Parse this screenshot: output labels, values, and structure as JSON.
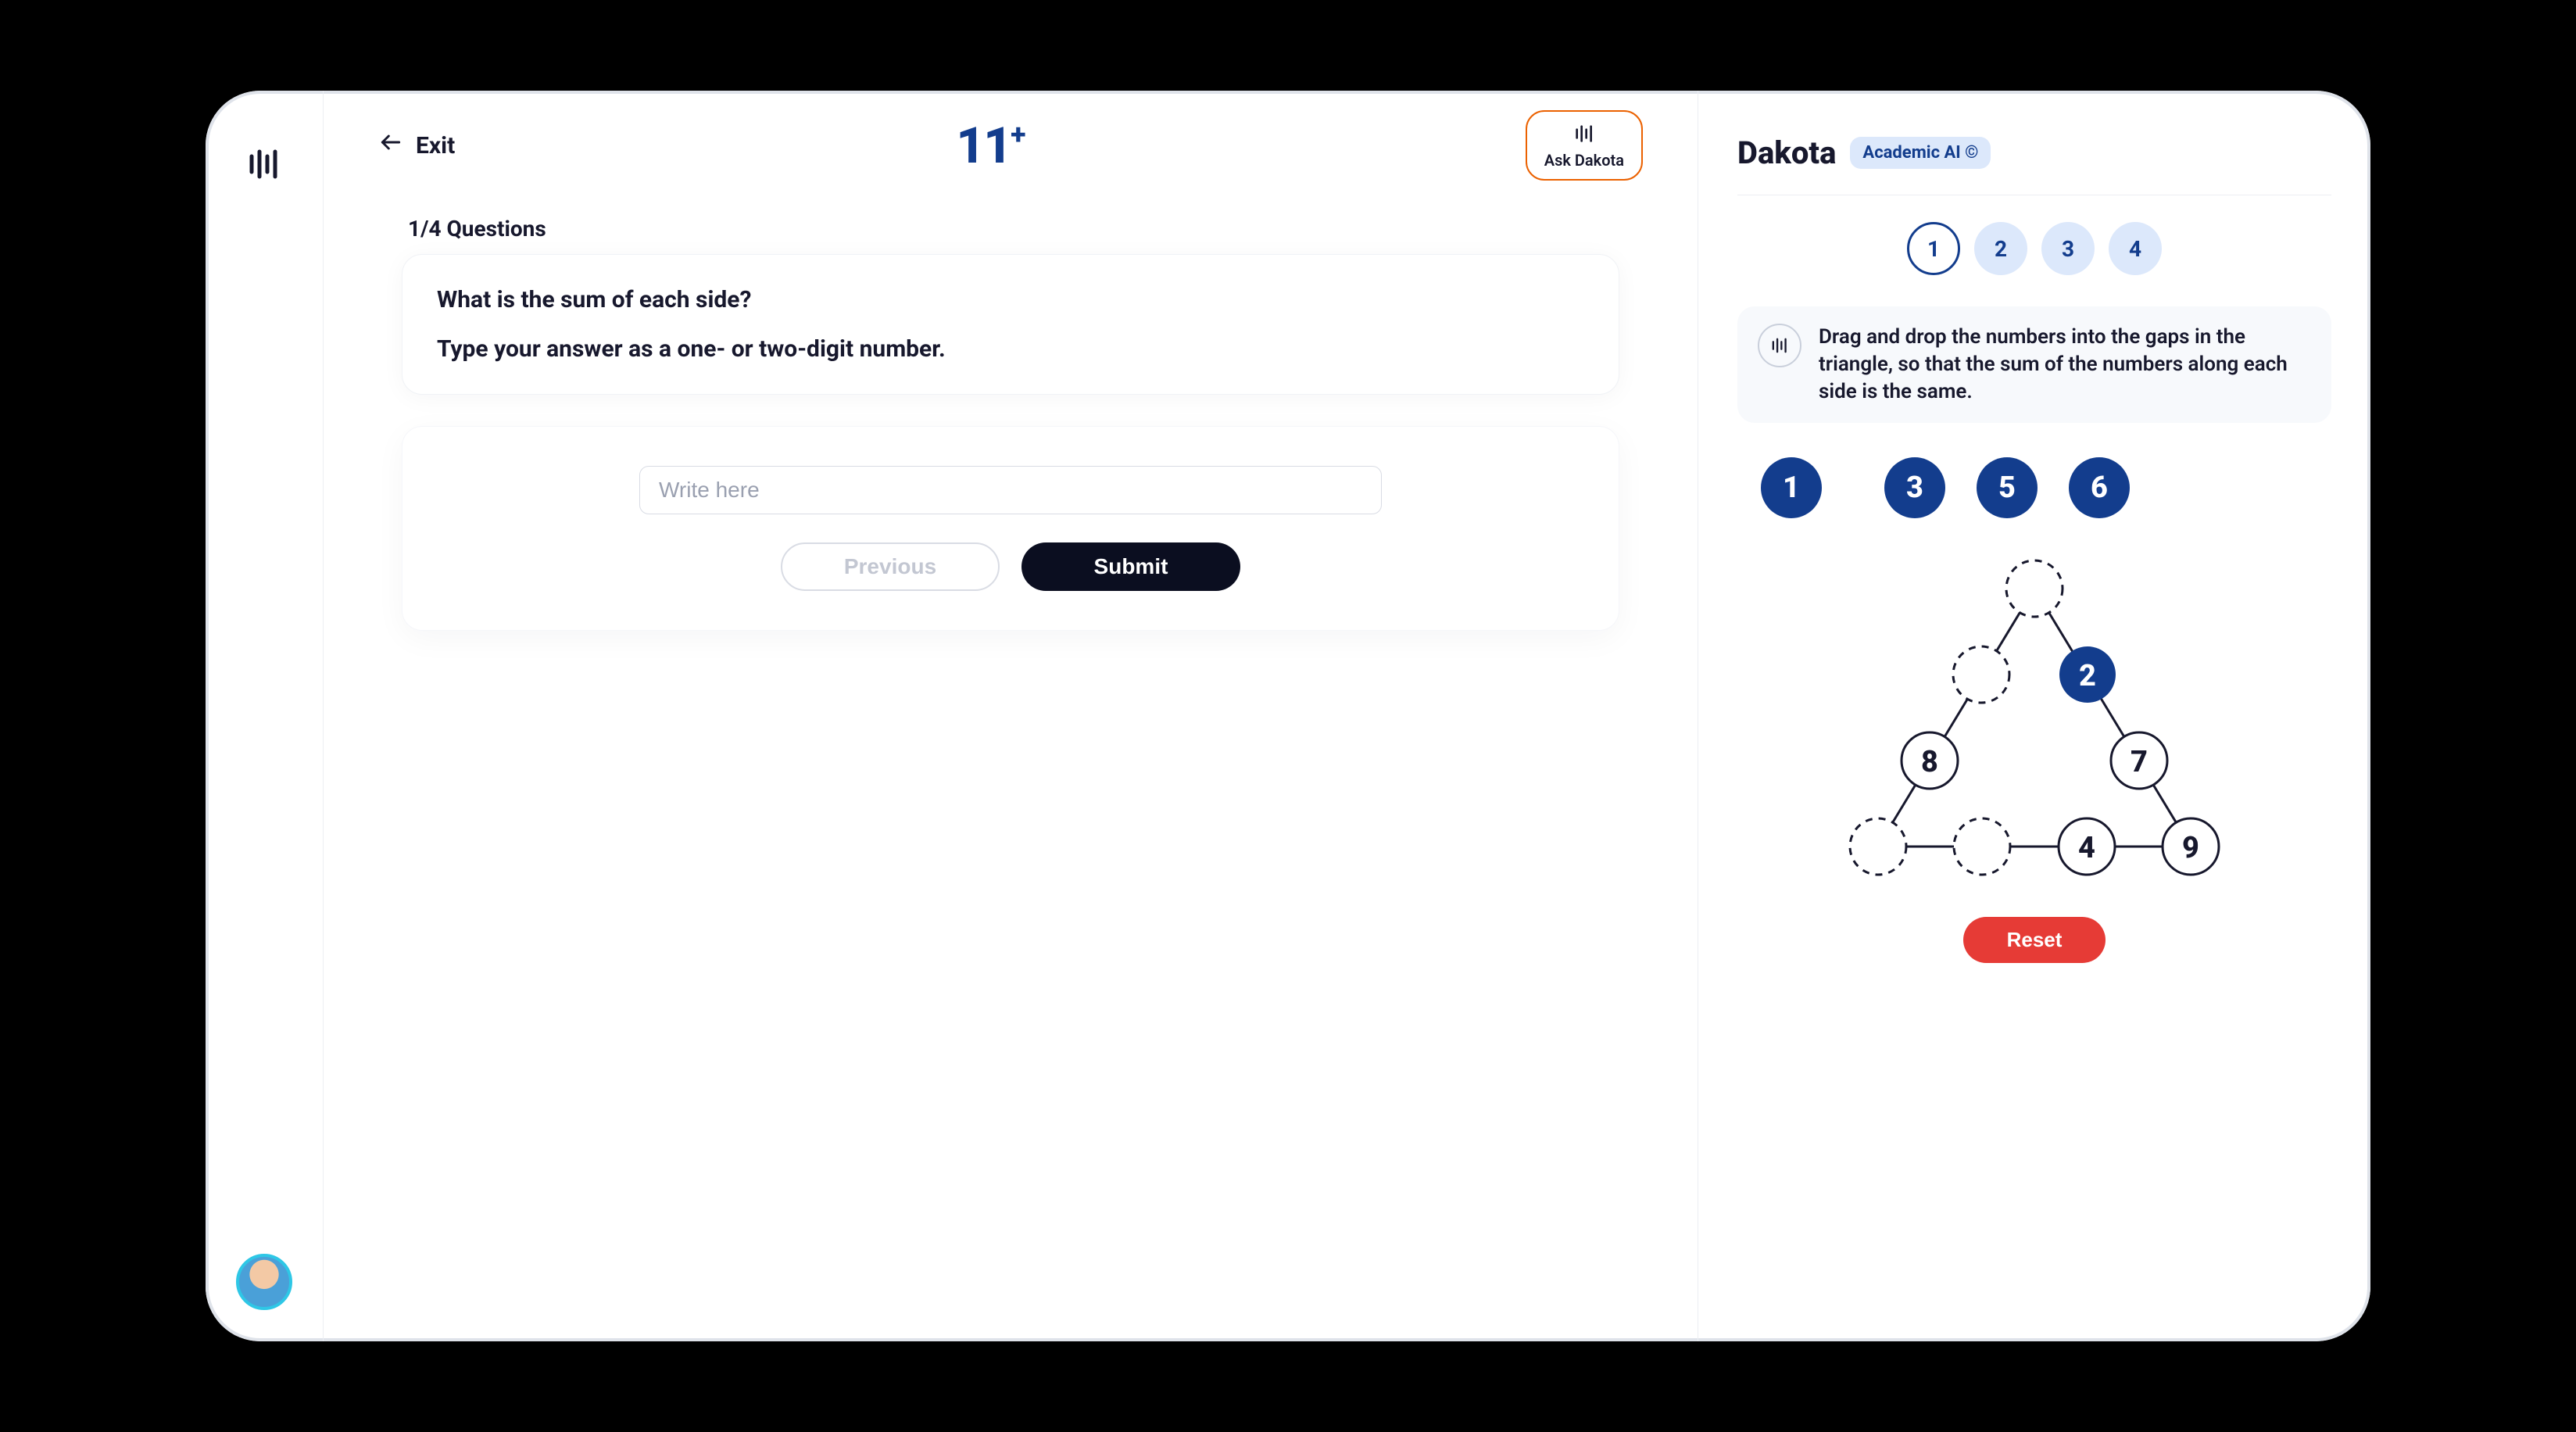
{
  "header": {
    "exit_label": "Exit",
    "title_main": "11",
    "title_plus": "+",
    "ask_dakota_label": "Ask Dakota"
  },
  "question": {
    "progress": "1/4 Questions",
    "text": "What is the sum of each side?",
    "subtext": "Type your answer as a one- or two-digit number.",
    "input_placeholder": "Write here",
    "previous_label": "Previous",
    "submit_label": "Submit"
  },
  "dakota": {
    "name": "Dakota",
    "badge": "Academic AI ©",
    "steps": [
      "1",
      "2",
      "3",
      "4"
    ],
    "active_step": 0,
    "instruction": "Drag and drop the numbers into the gaps in the triangle, so that the sum of the numbers along each side is the same.",
    "pool_left": "1",
    "pool_right": [
      "3",
      "5",
      "6"
    ],
    "triangle": {
      "placed": {
        "right_upper": "2"
      },
      "fixed": {
        "left_lower": "8",
        "right_lower": "7",
        "bottom_center": "4",
        "bottom_right": "9"
      }
    },
    "reset_label": "Reset"
  }
}
